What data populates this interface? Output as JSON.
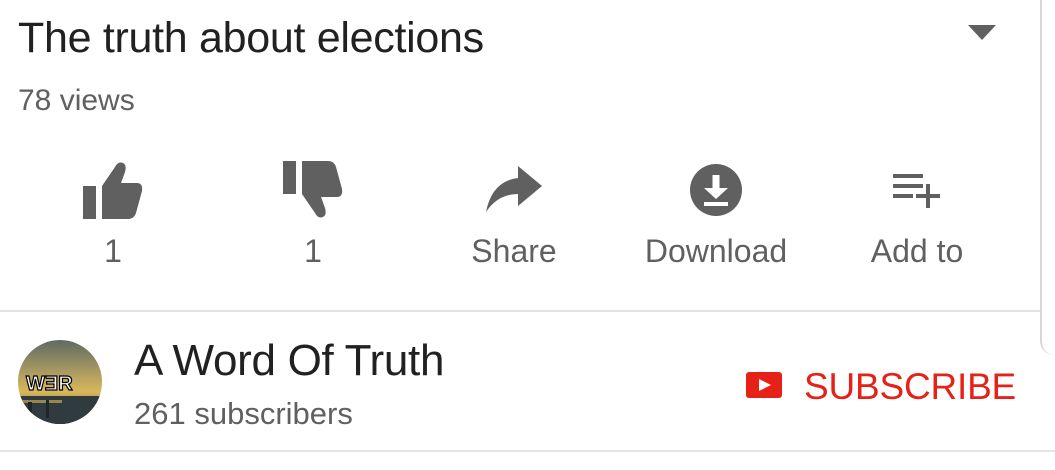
{
  "video": {
    "title": "The truth about elections",
    "views": "78 views"
  },
  "actions": [
    {
      "id": "like",
      "label": "1",
      "icon": "thumb-up-icon"
    },
    {
      "id": "dislike",
      "label": "1",
      "icon": "thumb-down-icon"
    },
    {
      "id": "share",
      "label": "Share",
      "icon": "share-arrow-icon"
    },
    {
      "id": "download",
      "label": "Download",
      "icon": "download-icon"
    },
    {
      "id": "add-to",
      "label": "Add to",
      "icon": "playlist-add-icon"
    }
  ],
  "channel": {
    "name": "A Word Of Truth",
    "subscribers": "261 subscribers",
    "avatar_text": "WƎR",
    "subscribe_label": "SUBSCRIBE"
  },
  "colors": {
    "text_primary": "#212121",
    "text_secondary": "#606060",
    "icon": "#606060",
    "subscribe_red": "#e62117"
  }
}
